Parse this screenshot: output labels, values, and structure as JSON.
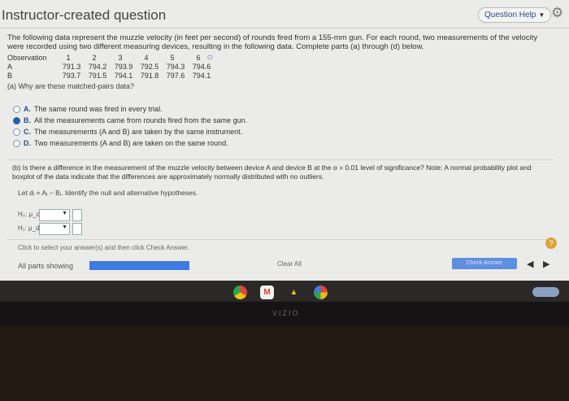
{
  "header": {
    "title": "Instructor-created question",
    "help_label": "Question Help"
  },
  "intro": "The following data represent the muzzle velocity (in feet per second) of rounds fired from a 155-mm gun. For each round, two measurements of the velocity were recorded using two different measuring devices, resulting in the following data. Complete parts (a) through (d) below.",
  "table": {
    "observation_label": "Observation",
    "observations": [
      "1",
      "2",
      "3",
      "4",
      "5",
      "6"
    ],
    "rows": [
      {
        "label": "A",
        "values": [
          "791.3",
          "794.2",
          "793.9",
          "792.5",
          "794.3",
          "794.6"
        ]
      },
      {
        "label": "B",
        "values": [
          "793.7",
          "791.5",
          "794.1",
          "791.8",
          "797.6",
          "794.1"
        ]
      }
    ]
  },
  "part_a": {
    "question": "(a) Why are these matched-pairs data?",
    "choices": [
      {
        "letter": "A.",
        "text": "The same round was fired in every trial.",
        "selected": false
      },
      {
        "letter": "B.",
        "text": "All the measurements came from rounds fired from the same gun.",
        "selected": true
      },
      {
        "letter": "C.",
        "text": "The measurements (A and B) are taken by the same instrument.",
        "selected": false
      },
      {
        "letter": "D.",
        "text": "Two measurements (A and B) are taken on the same round.",
        "selected": false
      }
    ]
  },
  "part_b": {
    "question": "(b) Is there a difference in the measurement of the muzzle velocity between device A and device B at the α = 0.01 level of significance? Note: A normal probability plot and boxplot of the data indicate that the differences are approximately normally distributed with no outliers.",
    "let_text": "Let dᵢ = Aᵢ − Bᵢ. Identify the null and alternative hypotheses.",
    "h0_label": "H₀: μ_d",
    "h1_label": "H₁: μ_d"
  },
  "footer": {
    "hint": "Click to select your answer(s) and then click Check Answer.",
    "all_parts": "All parts showing",
    "progress": 1.0,
    "clear_all": "Clear All",
    "check_answer": "Check Answer",
    "help_icon": "?"
  },
  "monitor": {
    "brand": "VIZIO"
  },
  "taskbar": {
    "apps": [
      "chrome-icon",
      "gmail-icon",
      "drive-icon",
      "photos-icon"
    ]
  },
  "colors": {
    "accent": "#2b5ea8",
    "progress": "#3f7be0",
    "help_badge": "#d9a33a"
  }
}
